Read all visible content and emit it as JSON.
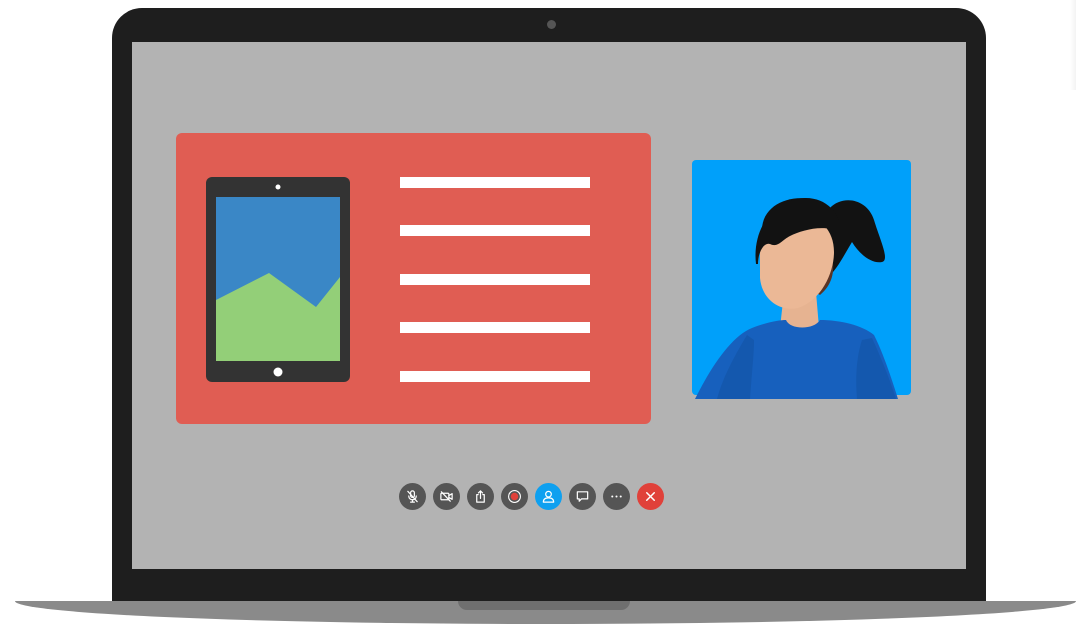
{
  "colors": {
    "laptop_frame": "#1e1e1e",
    "screen_bg": "#b3b3b3",
    "share_card": "#e05d53",
    "participant_bg": "#00a0fa",
    "toolbar_button": "#555555",
    "toolbar_active": "#0ea0f0",
    "toolbar_end_call": "#e0413a"
  },
  "shared_content": {
    "text_line_count": 5,
    "image": "landscape-image-icon"
  },
  "participant": {
    "avatar": "woman-avatar"
  },
  "toolbar": {
    "buttons": [
      {
        "icon": "mic-off-icon",
        "state": "muted"
      },
      {
        "icon": "video-off-icon",
        "state": "off"
      },
      {
        "icon": "share-screen-icon",
        "state": "normal"
      },
      {
        "icon": "record-icon",
        "state": "normal"
      },
      {
        "icon": "participants-icon",
        "state": "active"
      },
      {
        "icon": "chat-icon",
        "state": "normal"
      },
      {
        "icon": "more-icon",
        "state": "normal"
      },
      {
        "icon": "end-call-icon",
        "state": "danger"
      }
    ]
  }
}
